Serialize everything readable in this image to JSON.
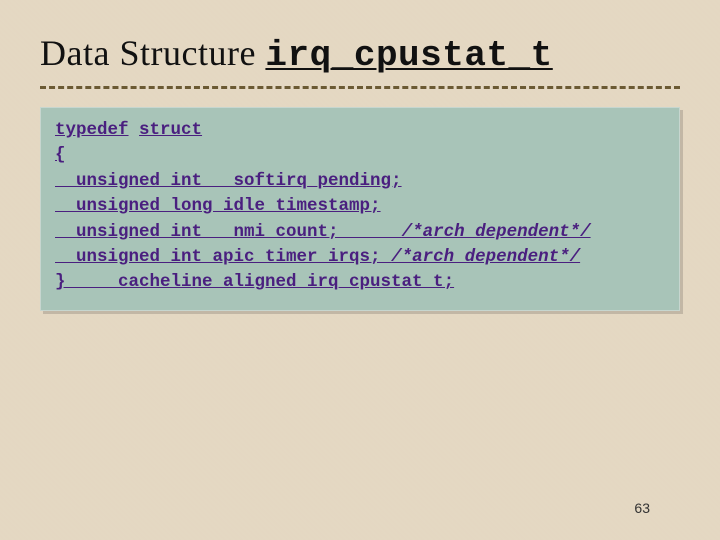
{
  "title_prefix": "Data Structure ",
  "title_code": "irq_cpustat_t",
  "code": {
    "l1a": "typedef",
    "l1b": " ",
    "l1c": "struct",
    "l2": "{",
    "l3": "  unsigned int __softirq_pending;",
    "l4": "  unsigned long idle_timestamp;",
    "l5a": "  unsigned int __nmi_count;      ",
    "l5b": "/*arch dependent*/",
    "l6a": "  unsigned int apic_timer_irqs; ",
    "l6b": "/*arch dependent*/",
    "l7": "} ____cacheline_aligned irq_cpustat_t;"
  },
  "page_number": "63"
}
